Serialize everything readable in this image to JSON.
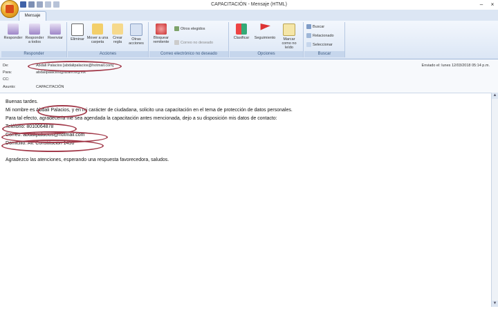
{
  "window": {
    "title": "CAPACITACIÓN - Mensaje (HTML)",
    "minimize": "–",
    "close": "×"
  },
  "tabs": [
    {
      "label": "Mensaje"
    }
  ],
  "ribbon": {
    "groups": [
      {
        "label": "Responder"
      },
      {
        "label": "Acciones"
      },
      {
        "label": "Correo electrónico no deseado"
      },
      {
        "label": "Opciones"
      },
      {
        "label": "Buscar"
      }
    ],
    "buttons": {
      "reply": "Responder",
      "reply_all": "Responder a todos",
      "forward": "Reenviar",
      "delete": "Eliminar",
      "move_folder": "Mover a una carpeta",
      "create_rule": "Crear regla",
      "other_actions": "Otras acciones",
      "block_sender": "Bloquear remitente",
      "other_senders": "Otros elegidos",
      "not_junk": "Correo no deseado",
      "categorize": "Clasificar",
      "follow_up": "Seguimiento",
      "mark_unread": "Marcar como no leído",
      "find": "Buscar",
      "related": "Relacionado",
      "select": "Seleccionar"
    }
  },
  "header": {
    "from_label": "De:",
    "from_value": "Abdali Palacios [abdalipalacios@hotmail.com]",
    "to_label": "Para:",
    "to_value": "abdalipalacios@itzam.org.mx",
    "cc_label": "CC:",
    "cc_value": "",
    "subject_label": "Asunto:",
    "subject_value": "CAPACITACIÓN",
    "sent": "Enviado el: lunes 12/03/2018 05:14 p.m."
  },
  "body": {
    "greeting": "Buenas tardes.",
    "line1": "Mi nombre es Abdali Palacios, y en mi carácter de ciudadana, solicito una capacitación en el tema de protección de datos personales.",
    "line2": "Para tal efecto, agradecería me sea agendada la capacitación antes mencionada, dejo a su disposición mis datos de contacto:",
    "phone": "Teléfono: 8010064878",
    "email": "Correo: abdalipalacios@hotmail.com",
    "address": "Domicilio: Av. Constitución 1450",
    "closing": "Agradezco las atenciones, esperando una respuesta favorecedora, saludos."
  },
  "icons": [
    "office-button",
    "save-icon",
    "undo-icon",
    "redo-icon",
    "reply-icon",
    "reply-all-icon",
    "forward-icon",
    "delete-icon",
    "folder-icon",
    "rule-icon",
    "actions-icon",
    "block-icon",
    "category-icon",
    "flag-icon",
    "envelope-icon",
    "find-icon"
  ]
}
